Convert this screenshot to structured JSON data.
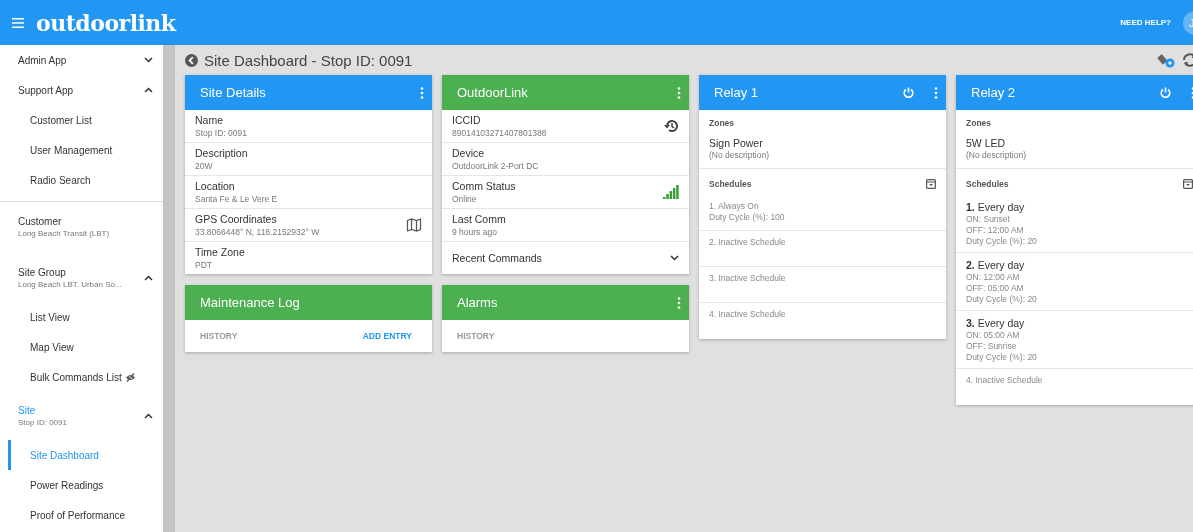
{
  "header": {
    "logo": "outdoorlink",
    "help": "NEED HELP?",
    "avatar": "J"
  },
  "sidebar": {
    "items": [
      {
        "kind": "section",
        "label": "Admin App",
        "expanded": false,
        "selected": false
      },
      {
        "kind": "section",
        "label": "Support App",
        "expanded": true,
        "selected": false
      },
      {
        "kind": "link",
        "label": "Customer List",
        "selected": false,
        "hidden": false
      },
      {
        "kind": "link",
        "label": "User Management",
        "selected": false,
        "hidden": false
      },
      {
        "kind": "link",
        "label": "Radio Search",
        "selected": false,
        "hidden": false
      },
      {
        "kind": "divider"
      },
      {
        "kind": "info",
        "label": "Customer",
        "sub": "Long Beach Transit (LBT)"
      },
      {
        "kind": "section",
        "label": "Site Group",
        "sub": "Long Beach LBT. Urban So...",
        "expanded": true,
        "selected": false
      },
      {
        "kind": "link",
        "label": "List View",
        "selected": false,
        "hidden": false
      },
      {
        "kind": "link",
        "label": "Map View",
        "selected": false,
        "hidden": false
      },
      {
        "kind": "link",
        "label": "Bulk Commands List",
        "selected": false,
        "hidden": true
      },
      {
        "kind": "section",
        "label": "Site",
        "sub": "Stop ID: 0091",
        "expanded": true,
        "selected": true
      },
      {
        "kind": "link",
        "label": "Site Dashboard",
        "selected": true,
        "hidden": false
      },
      {
        "kind": "link",
        "label": "Power Readings",
        "selected": false,
        "hidden": false
      },
      {
        "kind": "link",
        "label": "Proof of Performance",
        "selected": false,
        "hidden": false
      }
    ]
  },
  "page": {
    "title": "Site Dashboard - Stop ID: 0091"
  },
  "columns": [
    [
      {
        "kind": "details",
        "title": "Site Details",
        "color": "#2196f3",
        "menu": true,
        "rows": [
          {
            "kind": "plain",
            "label": "Name",
            "value": "Stop ID: 0091"
          },
          {
            "kind": "plain",
            "label": "Description",
            "value": "20W"
          },
          {
            "kind": "plain",
            "label": "Location",
            "value": "Santa Fe & Le Vere E"
          },
          {
            "kind": "map",
            "label": "GPS Coordinates",
            "value": "33.8066448° N, 118.2152932° W"
          },
          {
            "kind": "plain",
            "label": "Time Zone",
            "value": "PDT"
          }
        ]
      },
      {
        "kind": "actions",
        "title": "Maintenance Log",
        "color": "#4caf50",
        "menu": false,
        "actions": [
          {
            "label": "HISTORY",
            "primary": false
          },
          {
            "label": "ADD ENTRY",
            "primary": true
          }
        ]
      }
    ],
    [
      {
        "kind": "details",
        "title": "OutdoorLink",
        "color": "#4caf50",
        "menu": true,
        "rows": [
          {
            "kind": "history",
            "label": "ICCID",
            "value": "89014103271407801388"
          },
          {
            "kind": "plain",
            "label": "Device",
            "value": "OutdoorLink 2-Port DC"
          },
          {
            "kind": "signal",
            "label": "Comm Status",
            "value": "Online"
          },
          {
            "kind": "plain",
            "label": "Last Comm",
            "value": "9 hours ago"
          },
          {
            "kind": "expander",
            "label": "Recent Commands",
            "expanded": false
          }
        ]
      },
      {
        "kind": "actions",
        "title": "Alarms",
        "color": "#4caf50",
        "menu": true,
        "actions": [
          {
            "label": "HISTORY",
            "primary": false
          }
        ]
      }
    ],
    [
      {
        "kind": "relay",
        "title": "Relay 1",
        "color": "#2196f3",
        "menu": true,
        "zones_label": "Zones",
        "zones": [
          {
            "name": "Sign Power",
            "description": "(No description)"
          }
        ],
        "schedules_label": "Schedules",
        "schedules": [
          {
            "title": "1. Always On",
            "lines": [
              "Duty Cycle (%): 100"
            ],
            "active": false
          },
          {
            "title": "2. Inactive Schedule",
            "active": false
          },
          {
            "title": "3. Inactive Schedule",
            "active": false
          },
          {
            "title": "4. Inactive Schedule",
            "active": false
          }
        ]
      }
    ],
    [
      {
        "kind": "relay",
        "title": "Relay 2",
        "color": "#2196f3",
        "menu": true,
        "zones_label": "Zones",
        "zones": [
          {
            "name": "5W LED",
            "description": "(No description)"
          }
        ],
        "schedules_label": "Schedules",
        "schedules": [
          {
            "title": "**1.** Every day",
            "lines": [
              "ON:  Sunset",
              "OFF: 12:00 AM",
              "Duty Cycle (%): 20"
            ],
            "active": true
          },
          {
            "title": "**2.** Every day",
            "lines": [
              "ON:  12:00 AM",
              "OFF: 05:00 AM",
              "Duty Cycle (%): 20"
            ],
            "active": true
          },
          {
            "title": "**3.** Every day",
            "lines": [
              "ON:  05:00 AM",
              "OFF: Sunrise",
              "Duty Cycle (%): 20"
            ],
            "active": true
          },
          {
            "title": "4. Inactive Schedule",
            "active": false
          }
        ]
      }
    ]
  ]
}
